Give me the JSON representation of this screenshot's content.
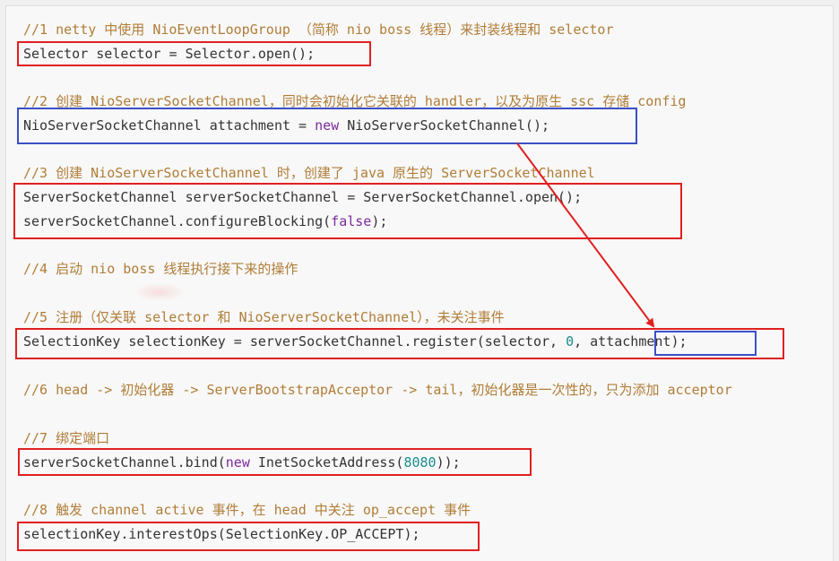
{
  "lines": [
    {
      "id": "c1",
      "segments": [
        {
          "cls": "comment",
          "text": "//1 netty 中使用 NioEventLoopGroup （简称 nio boss 线程）来封装线程和 selector"
        }
      ]
    },
    {
      "id": "l1",
      "segments": [
        {
          "cls": "plain",
          "text": "Selector selector = Selector.open();"
        }
      ]
    },
    {
      "id": "c2",
      "segments": [
        {
          "cls": "comment",
          "text": "//2 创建 NioServerSocketChannel，同时会初始化它关联的 handler，以及为原生 ssc 存储 config"
        }
      ]
    },
    {
      "id": "l2",
      "segments": [
        {
          "cls": "plain",
          "text": "NioServerSocketChannel attachment = "
        },
        {
          "cls": "kw",
          "text": "new"
        },
        {
          "cls": "plain",
          "text": " NioServerSocketChannel();"
        }
      ]
    },
    {
      "id": "c3",
      "segments": [
        {
          "cls": "comment",
          "text": "//3 创建 NioServerSocketChannel 时，创建了 java 原生的 ServerSocketChannel"
        }
      ]
    },
    {
      "id": "l3a",
      "segments": [
        {
          "cls": "plain",
          "text": "ServerSocketChannel serverSocketChannel = ServerSocketChannel.open();"
        }
      ]
    },
    {
      "id": "l3b",
      "segments": [
        {
          "cls": "plain",
          "text": "serverSocketChannel.configureBlocking("
        },
        {
          "cls": "kw",
          "text": "false"
        },
        {
          "cls": "plain",
          "text": ");"
        }
      ]
    },
    {
      "id": "c4",
      "segments": [
        {
          "cls": "comment",
          "text": "//4 启动 nio boss 线程执行接下来的操作"
        }
      ]
    },
    {
      "id": "c5",
      "segments": [
        {
          "cls": "comment",
          "text": "//5 注册（仅关联 selector 和 NioServerSocketChannel），未关注事件"
        }
      ]
    },
    {
      "id": "l5",
      "segments": [
        {
          "cls": "plain",
          "text": "SelectionKey selectionKey = serverSocketChannel.register(selector, "
        },
        {
          "cls": "num",
          "text": "0"
        },
        {
          "cls": "plain",
          "text": ", attachment);"
        }
      ]
    },
    {
      "id": "c6",
      "segments": [
        {
          "cls": "comment",
          "text": "//6 head -> 初始化器 -> ServerBootstrapAcceptor -> tail，初始化器是一次性的，只为添加 acceptor"
        }
      ]
    },
    {
      "id": "c7",
      "segments": [
        {
          "cls": "comment",
          "text": "//7 绑定端口"
        }
      ]
    },
    {
      "id": "l7",
      "segments": [
        {
          "cls": "plain",
          "text": "serverSocketChannel.bind("
        },
        {
          "cls": "kw",
          "text": "new"
        },
        {
          "cls": "plain",
          "text": " InetSocketAddress("
        },
        {
          "cls": "num",
          "text": "8080"
        },
        {
          "cls": "plain",
          "text": "));"
        }
      ]
    },
    {
      "id": "c8",
      "segments": [
        {
          "cls": "comment",
          "text": "//8 触发 channel active 事件，在 head 中关注 op_accept 事件"
        }
      ]
    },
    {
      "id": "l8",
      "segments": [
        {
          "cls": "plain",
          "text": "selectionKey.interestOps(SelectionKey.OP_ACCEPT);"
        }
      ]
    }
  ],
  "colors": {
    "comment": "#b07d37",
    "keyword": "#7b2a9c",
    "number": "#1a8c8c",
    "highlight_red": "#e02020",
    "highlight_blue": "#3b4fc7"
  }
}
